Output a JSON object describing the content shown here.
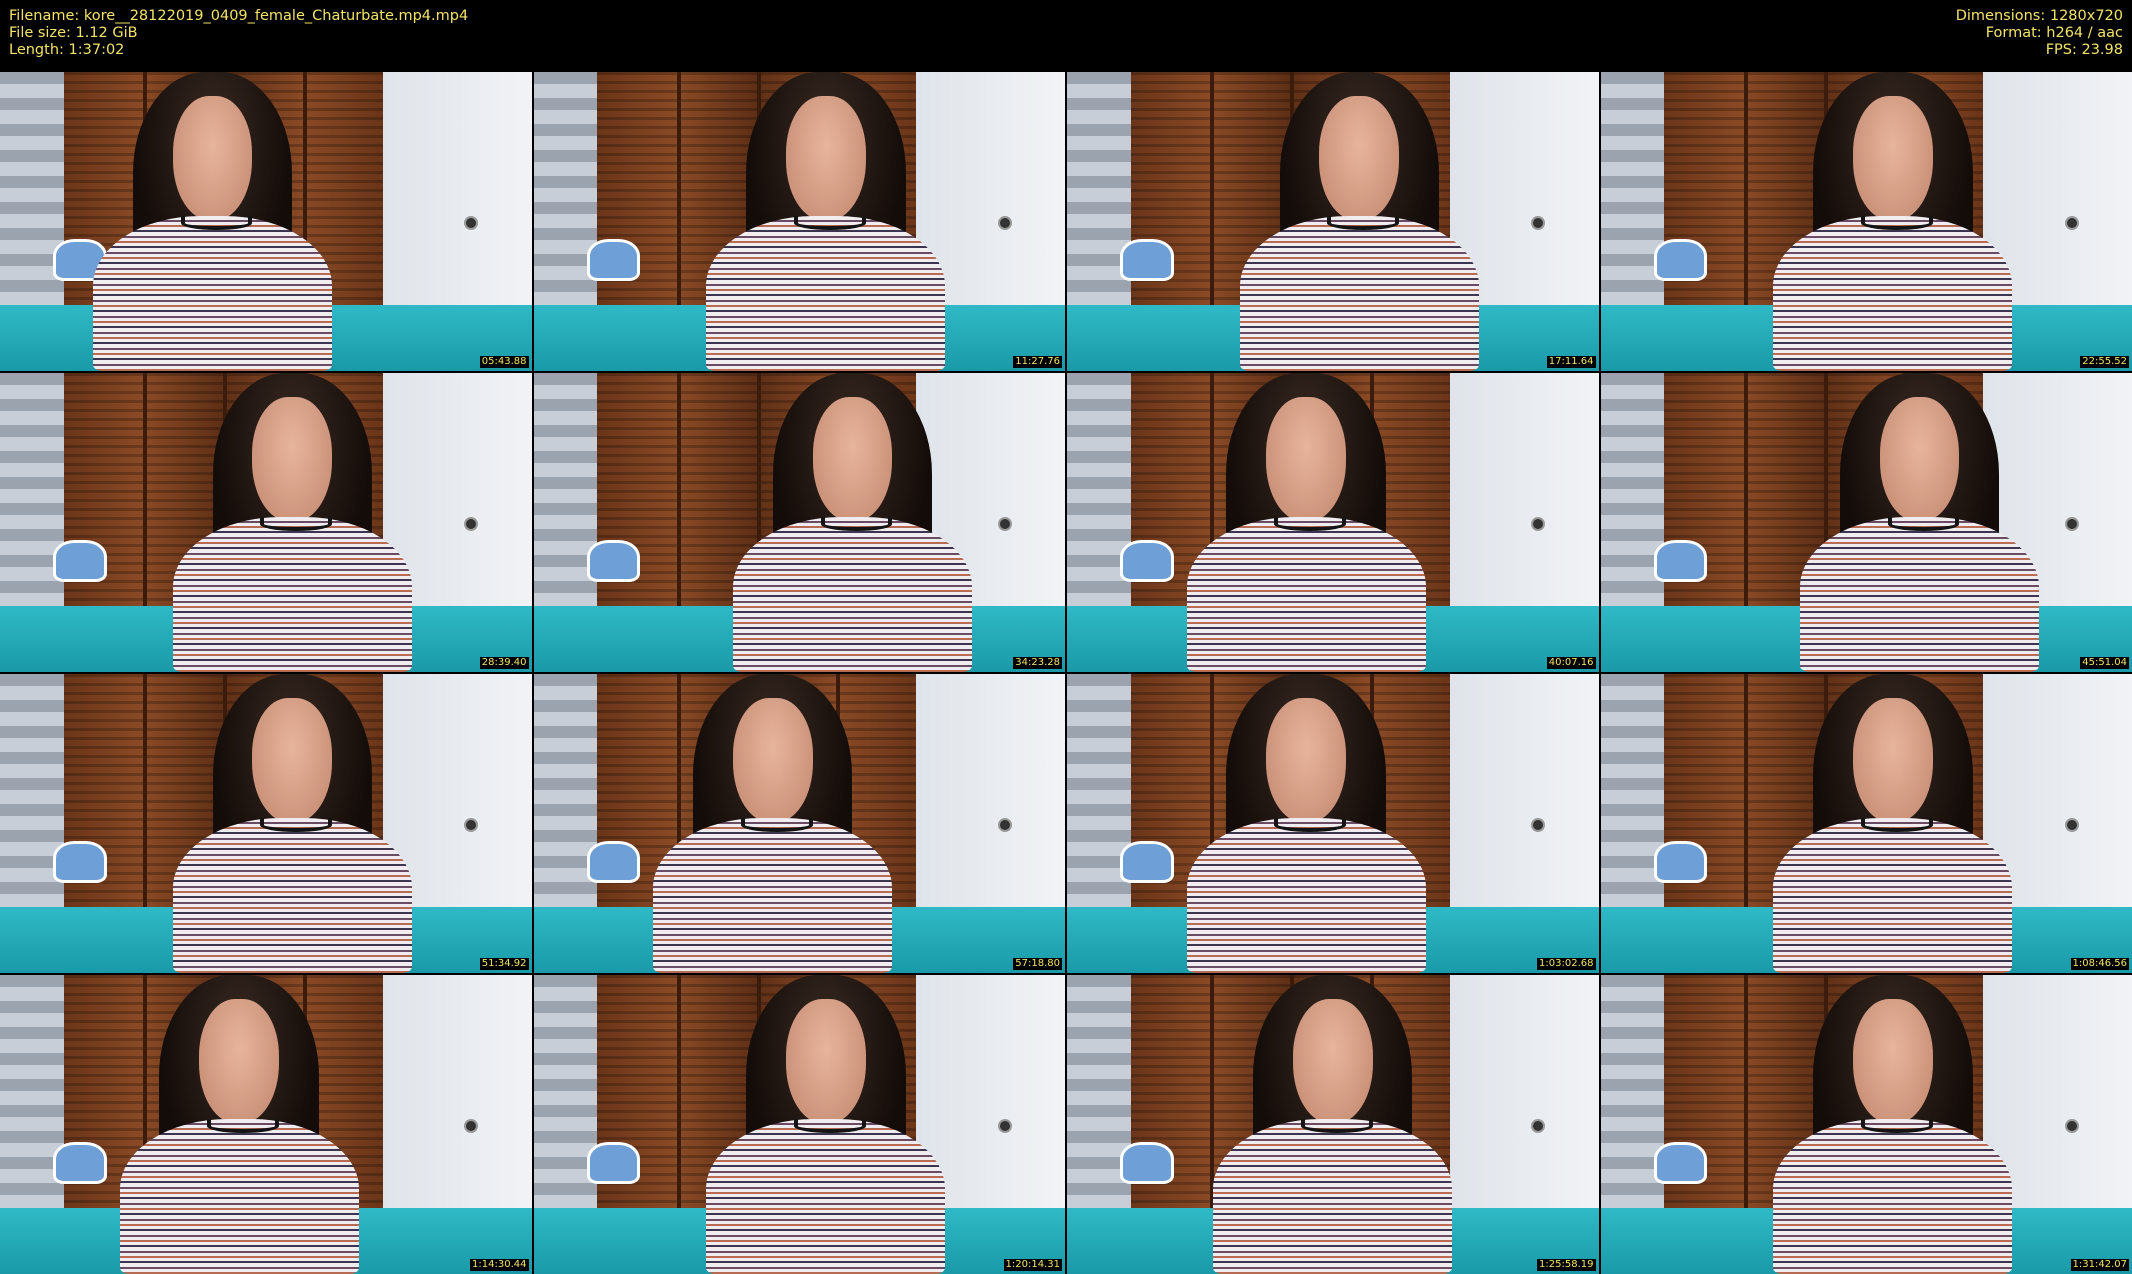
{
  "header": {
    "filename": "Filename: kore__28122019_0409_female_Chaturbate.mp4.mp4",
    "file_size": "File size: 1.12 GiB",
    "length": "Length: 1:37:02",
    "dimensions": "Dimensions: 1280x720",
    "format": "Format: h264 / aac",
    "fps": "FPS: 23.98"
  },
  "thumbnails": [
    {
      "timestamp": "05:43.88"
    },
    {
      "timestamp": "11:27.76"
    },
    {
      "timestamp": "17:11.64"
    },
    {
      "timestamp": "22:55.52"
    },
    {
      "timestamp": "28:39.40"
    },
    {
      "timestamp": "34:23.28"
    },
    {
      "timestamp": "40:07.16"
    },
    {
      "timestamp": "45:51.04"
    },
    {
      "timestamp": "51:34.92"
    },
    {
      "timestamp": "57:18.80"
    },
    {
      "timestamp": "1:03:02.68"
    },
    {
      "timestamp": "1:08:46.56"
    },
    {
      "timestamp": "1:14:30.44"
    },
    {
      "timestamp": "1:20:14.31"
    },
    {
      "timestamp": "1:25:58.19"
    },
    {
      "timestamp": "1:31:42.07"
    }
  ],
  "colors": {
    "text": "#f3e36a",
    "background": "#000000"
  }
}
